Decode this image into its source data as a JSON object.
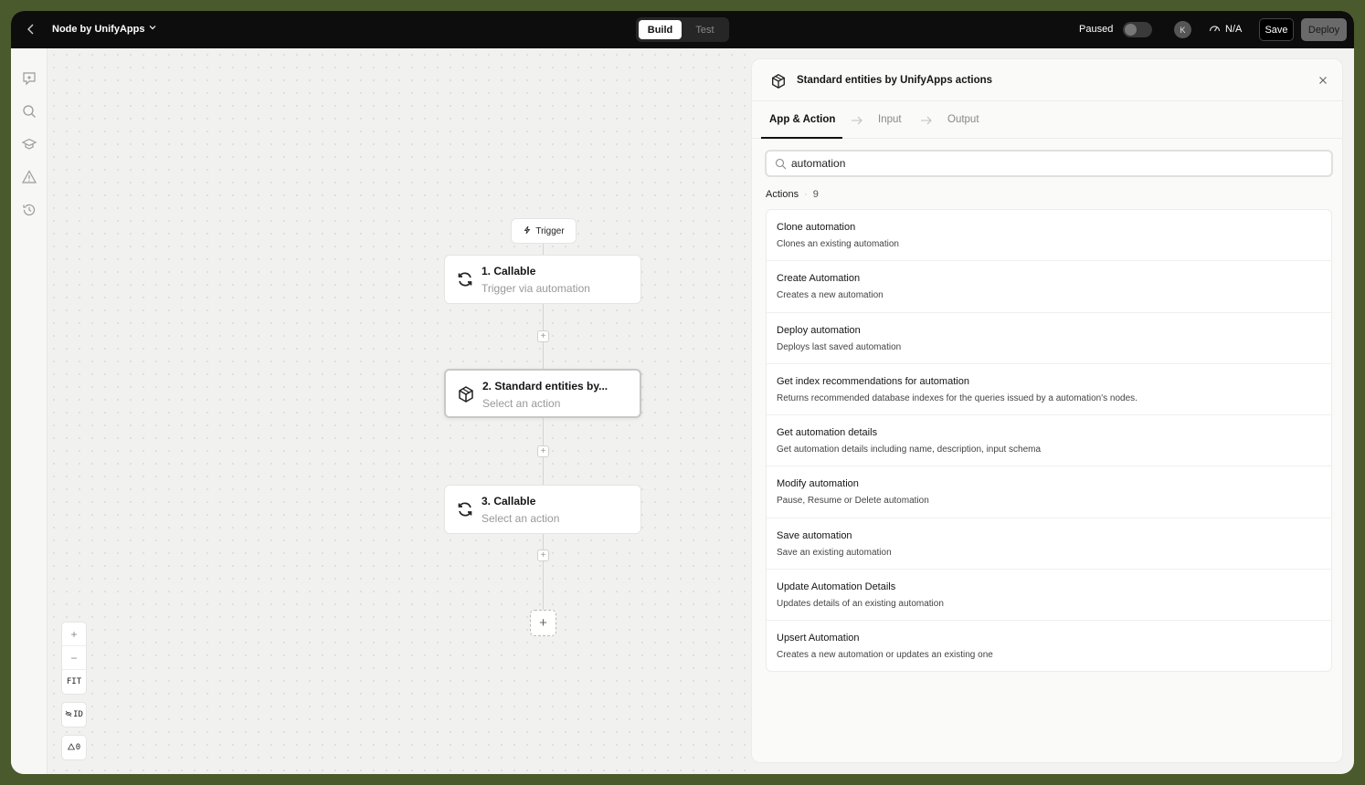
{
  "topbar": {
    "app_title": "Node by UnifyApps",
    "mode_tabs": [
      "Build",
      "Test"
    ],
    "active_mode": "Build",
    "status_label": "Paused",
    "avatar_initial": "K",
    "perf_label": "N/A",
    "save_label": "Save",
    "deploy_label": "Deploy"
  },
  "sidebar": {
    "icons": [
      "ai-assistant-icon",
      "search-icon",
      "learn-icon",
      "warning-icon",
      "history-icon"
    ]
  },
  "canvas": {
    "trigger_label": "Trigger",
    "nodes": [
      {
        "title": "1. Callable",
        "subtitle": "Trigger via automation",
        "icon": "refresh-icon"
      },
      {
        "title": "2. Standard entities by...",
        "subtitle": "Select an action",
        "icon": "cube-icon",
        "selected": true
      },
      {
        "title": "3. Callable",
        "subtitle": "Select an action",
        "icon": "refresh-icon"
      }
    ],
    "zoom": {
      "in": "+",
      "out": "−",
      "fit": "FIT"
    },
    "id_toggle_label": "ID",
    "warnings_count": "0"
  },
  "panel": {
    "title": "Standard entities by UnifyApps actions",
    "tabs": [
      "App & Action",
      "Input",
      "Output"
    ],
    "active_tab": "App & Action",
    "search_value": "automation",
    "actions_label": "Actions",
    "actions_count": "9",
    "actions": [
      {
        "title": "Clone automation",
        "desc": "Clones an existing automation"
      },
      {
        "title": "Create Automation",
        "desc": "Creates a new automation"
      },
      {
        "title": "Deploy automation",
        "desc": "Deploys last saved automation"
      },
      {
        "title": "Get index recommendations for automation",
        "desc": "Returns recommended database indexes for the queries issued by a automation's nodes."
      },
      {
        "title": "Get automation details",
        "desc": "Get automation details including name, description, input schema"
      },
      {
        "title": "Modify automation",
        "desc": "Pause, Resume or Delete automation"
      },
      {
        "title": "Save automation",
        "desc": "Save an existing automation"
      },
      {
        "title": "Update Automation Details",
        "desc": "Updates details of an existing automation"
      },
      {
        "title": "Upsert Automation",
        "desc": "Creates a new automation or updates an existing one"
      }
    ]
  }
}
